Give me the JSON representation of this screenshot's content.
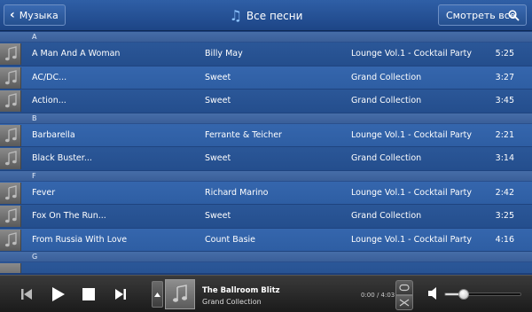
{
  "header": {
    "back_label": "Музыка",
    "title": "Все песни",
    "view_all_label": "Смотреть все"
  },
  "sections": [
    {
      "letter": "A",
      "songs": [
        {
          "title": "A Man And A Woman",
          "artist": "Billy May",
          "album": "Lounge Vol.1 - Cocktail Party",
          "duration": "5:25"
        },
        {
          "title": "AC/DC...",
          "artist": "Sweet",
          "album": "Grand Collection",
          "duration": "3:27"
        },
        {
          "title": "Action...",
          "artist": "Sweet",
          "album": "Grand Collection",
          "duration": "3:45"
        }
      ]
    },
    {
      "letter": "B",
      "songs": [
        {
          "title": "Barbarella",
          "artist": "Ferrante & Teicher",
          "album": "Lounge Vol.1 - Cocktail Party",
          "duration": "2:21"
        },
        {
          "title": "Black Buster...",
          "artist": "Sweet",
          "album": "Grand Collection",
          "duration": "3:14"
        }
      ]
    },
    {
      "letter": "F",
      "songs": [
        {
          "title": "Fever",
          "artist": "Richard Marino",
          "album": "Lounge Vol.1 - Cocktail Party",
          "duration": "2:42"
        },
        {
          "title": "Fox On The Run...",
          "artist": "Sweet",
          "album": "Grand Collection",
          "duration": "3:25"
        },
        {
          "title": "From Russia With Love",
          "artist": "Count Basie",
          "album": "Lounge Vol.1 - Cocktail Party",
          "duration": "4:16"
        }
      ]
    },
    {
      "letter": "G",
      "songs": []
    }
  ],
  "player": {
    "now_playing_title": "The Ballroom Blitz",
    "now_playing_album": "Grand Collection",
    "time": "0:00 / 4:03",
    "volume_fraction": 0.25
  },
  "colors": {
    "header_bg": "#2f5fa6",
    "list_bg": "#1c3f7a",
    "accent_note": "#8ec5ff",
    "player_bg": "#2a2a2a"
  }
}
